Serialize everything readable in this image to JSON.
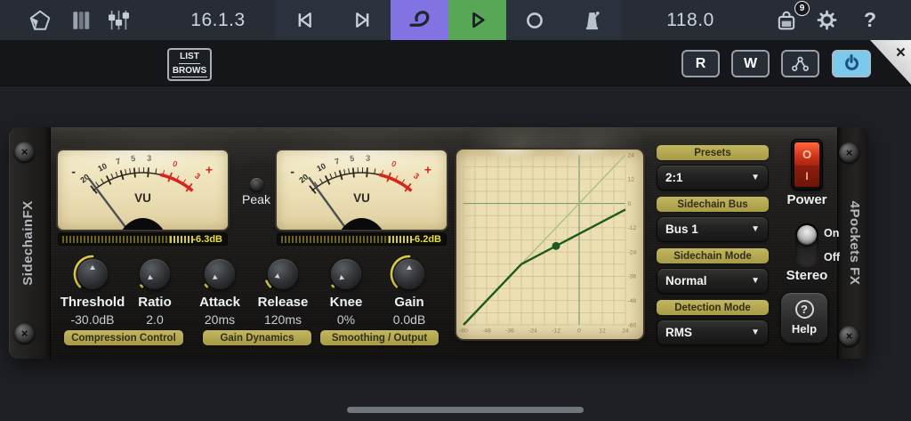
{
  "icons": {
    "close": "×",
    "caret": "▼",
    "screw": "×",
    "question_mark": "?"
  },
  "topbar": {
    "time": "16.1.3",
    "tempo": "118.0",
    "store_badge": "9",
    "help": "?"
  },
  "toolbar": {
    "list_button": {
      "line1": "LIST",
      "line2": "BROWS"
    },
    "read": "R",
    "write": "W"
  },
  "plugin": {
    "left_title": "SidechainFX",
    "right_title": "4Pockets FX",
    "peak_label": "Peak",
    "meter_scale": {
      "labels": [
        "20",
        "10",
        "7",
        "5",
        "3",
        "0",
        "3"
      ],
      "minus": "-",
      "plus": "+",
      "unit_label": "VU"
    },
    "meters": [
      {
        "value": "-6.3dB",
        "needle_angle": -37
      },
      {
        "value": "-6.2dB",
        "needle_angle": -36
      }
    ],
    "knobs": [
      {
        "label": "Threshold",
        "value": "-30.0dB",
        "angle": 0
      },
      {
        "label": "Ratio",
        "value": "2.0",
        "angle": -129
      },
      {
        "label": "Attack",
        "value": "20ms",
        "angle": -127
      },
      {
        "label": "Release",
        "value": "120ms",
        "angle": -113
      },
      {
        "label": "Knee",
        "value": "0%",
        "angle": -131
      },
      {
        "label": "Gain",
        "value": "0.0dB",
        "angle": 0
      }
    ],
    "groups": [
      "Compression Control",
      "Gain Dynamics",
      "Smoothing / Output"
    ],
    "graph": {
      "type": "line",
      "x_ticks": [
        -60,
        -48,
        -36,
        -24,
        -12,
        0,
        12,
        24
      ],
      "y_ticks": [
        24,
        12,
        0,
        -12,
        -24,
        -36,
        -48,
        -60
      ],
      "unity_line": [
        [
          -60,
          -60
        ],
        [
          24,
          24
        ]
      ],
      "curve": [
        [
          -60,
          -60
        ],
        [
          -30,
          -30
        ],
        [
          24,
          -3
        ]
      ],
      "dot": [
        -12,
        -21
      ],
      "colors": {
        "curve": "#1d5a1f",
        "unity": "#a8bf7d",
        "grid": "#cfc08c",
        "zero": "#7e9a78",
        "label": "#8d8150"
      }
    },
    "selectors": [
      {
        "label": "Presets",
        "value": "2:1"
      },
      {
        "label": "Sidechain Bus",
        "value": "Bus 1"
      },
      {
        "label": "Sidechain Mode",
        "value": "Normal"
      },
      {
        "label": "Detection Mode",
        "value": "RMS"
      }
    ],
    "power": {
      "label": "Power",
      "off_symbol": "O",
      "on_symbol": "I"
    },
    "stereo": {
      "label": "Stereo",
      "on": "On",
      "off": "Off"
    },
    "help": {
      "label": "Help",
      "icon": "?"
    }
  }
}
